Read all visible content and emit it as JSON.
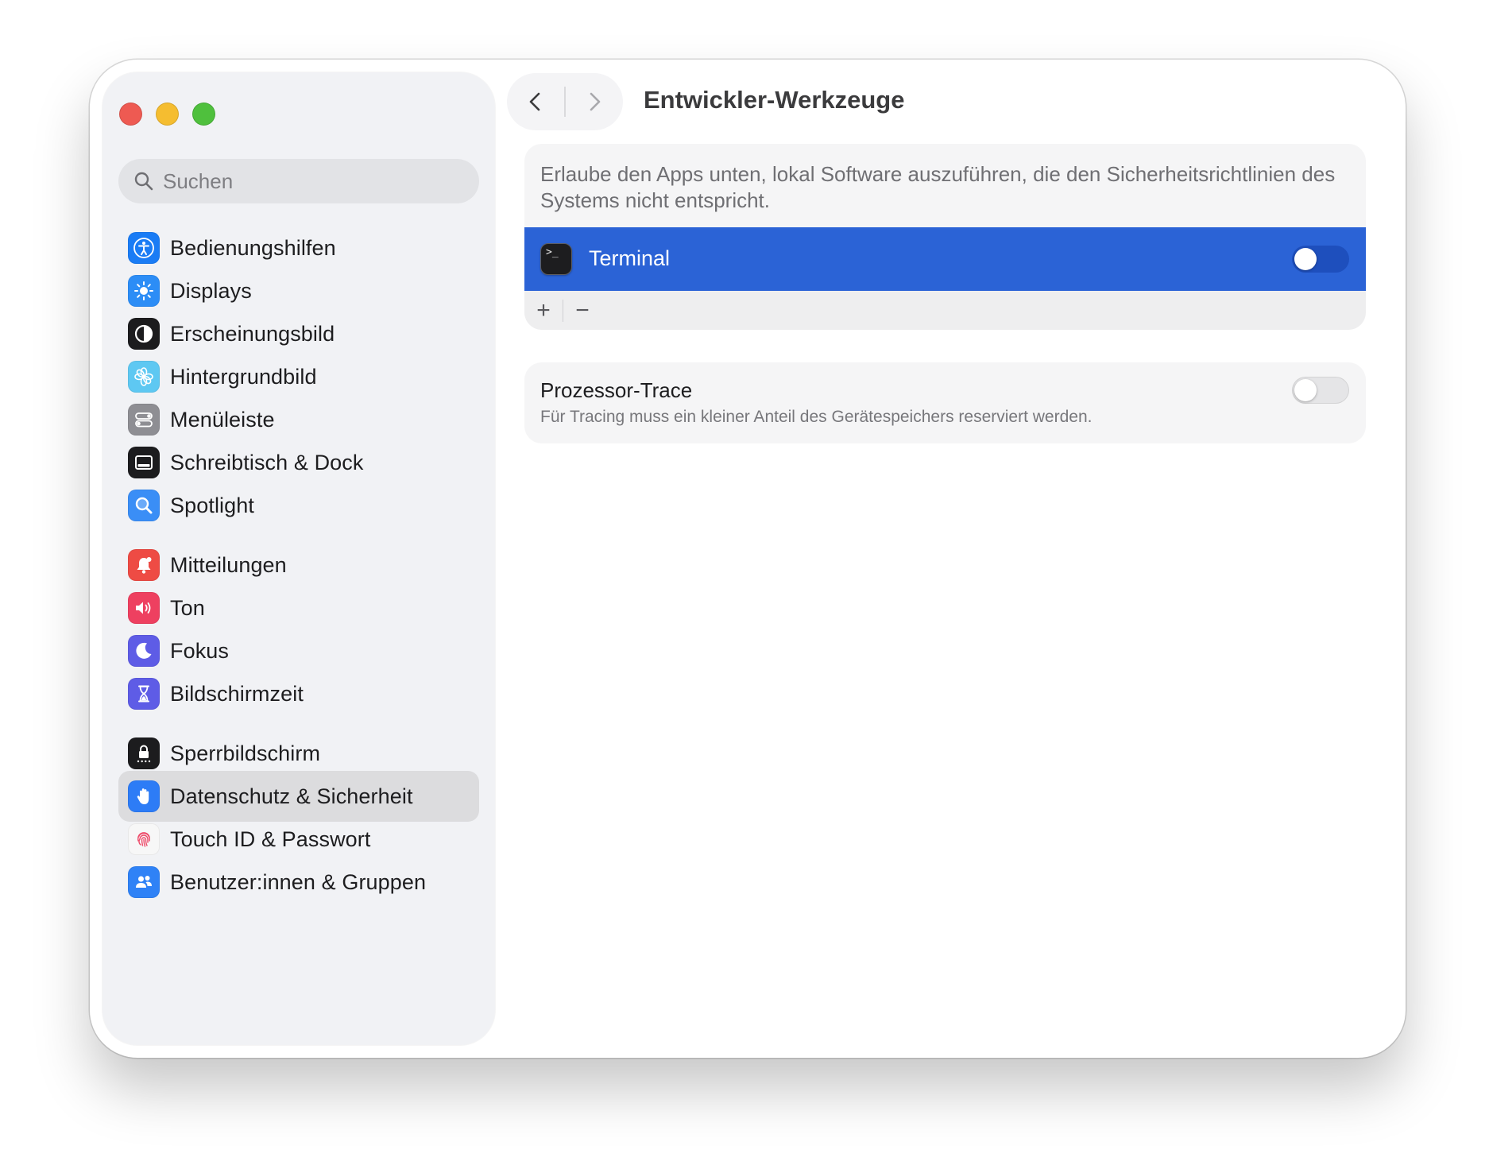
{
  "window": {
    "traffic_lights": {
      "close_color": "#ee5a52",
      "minimize_color": "#f5bd30",
      "maximize_color": "#4fc03d"
    }
  },
  "sidebar": {
    "search": {
      "placeholder": "Suchen",
      "value": "",
      "icon": "magnifying-glass-icon"
    },
    "items": [
      {
        "label": "Bedienungshilfen",
        "icon": "accessibility-icon",
        "color": "#1a7cf5",
        "selected": false
      },
      {
        "label": "Displays",
        "icon": "sun-icon",
        "color": "#2c8df6",
        "selected": false
      },
      {
        "label": "Erscheinungsbild",
        "icon": "appearance-icon",
        "color": "#1c1c1e",
        "selected": false
      },
      {
        "label": "Hintergrundbild",
        "icon": "flower-icon",
        "color": "#5ec8f2",
        "selected": false
      },
      {
        "label": "Menüleiste",
        "icon": "toggles-icon",
        "color": "#8e8e93",
        "selected": false
      },
      {
        "label": "Schreibtisch & Dock",
        "icon": "dock-icon",
        "color": "#1c1c1e",
        "selected": false
      },
      {
        "label": "Spotlight",
        "icon": "magnifier-icon",
        "color": "#3a8ef6",
        "selected": false
      },
      {
        "label": "Mitteilungen",
        "icon": "bell-icon",
        "color": "#ee4b44",
        "selected": false
      },
      {
        "label": "Ton",
        "icon": "speaker-icon",
        "color": "#ee4060",
        "selected": false
      },
      {
        "label": "Fokus",
        "icon": "moon-icon",
        "color": "#5e5ce6",
        "selected": false
      },
      {
        "label": "Bildschirmzeit",
        "icon": "hourglass-icon",
        "color": "#5e5ce6",
        "selected": false
      },
      {
        "label": "Sperrbildschirm",
        "icon": "lock-icon",
        "color": "#1c1c1e",
        "selected": false
      },
      {
        "label": "Datenschutz & Sicherheit",
        "icon": "hand-icon",
        "color": "#2d7cf6",
        "selected": true
      },
      {
        "label": "Touch ID & Passwort",
        "icon": "fingerprint-icon",
        "color": "#f7f7f7",
        "selected": false
      },
      {
        "label": "Benutzer:innen & Gruppen",
        "icon": "people-icon",
        "color": "#2f82f6",
        "selected": false
      }
    ]
  },
  "toolbar": {
    "back_icon": "chevron-left-icon",
    "forward_icon": "chevron-right-icon",
    "title": "Entwickler-Werkzeuge"
  },
  "content": {
    "developer_apps": {
      "description": "Erlaube den Apps unten, lokal Software auszuführen, die den Sicherheitsrichtlinien des Systems nicht entspricht.",
      "apps": [
        {
          "name": "Terminal",
          "icon": "terminal-icon",
          "icon_text": ">_",
          "enabled": true,
          "selected": true
        }
      ],
      "add_label": "+",
      "remove_label": "−",
      "selected_row_color": "#2b63d6"
    },
    "processor_trace": {
      "title": "Prozessor-Trace",
      "subtitle": "Für Tracing muss ein kleiner Anteil des Gerätespeichers reserviert werden.",
      "enabled": false
    }
  }
}
